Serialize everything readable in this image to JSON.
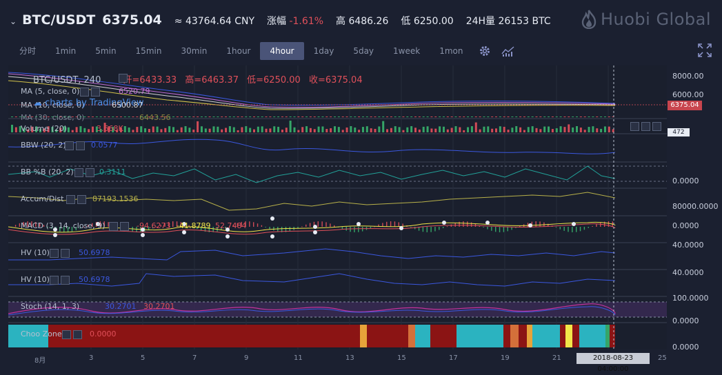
{
  "header": {
    "pair": "BTC/USDT",
    "price": "6375.04",
    "cny": "≈ 43764.64 CNY",
    "change_label": "涨幅",
    "change_value": "-1.61%",
    "high_label": "高",
    "high_value": "6486.26",
    "low_label": "低",
    "low_value": "6250.00",
    "vol_label": "24H量",
    "vol_value": "26153 BTC",
    "logo": "Huobi Global"
  },
  "timeframes": [
    "分时",
    "1min",
    "5min",
    "15min",
    "30min",
    "1hour",
    "4hour",
    "1day",
    "5day",
    "1week",
    "1mon"
  ],
  "active_timeframe": "4hour",
  "icons": {
    "settings": "gear-icon",
    "indicators": "chart-icon",
    "fullscreen": "expand-icon",
    "chevron": "chevron-down-icon"
  },
  "main_legend": {
    "title": "BTC/USDT, 240",
    "open_label": "开=",
    "open": "6433.33",
    "high_label": "高=",
    "high": "6463.37",
    "low_label": "低=",
    "low": "6250.00",
    "close_label": "收=",
    "close": "6375.04"
  },
  "watermark": "charts by TradingView",
  "indicators": [
    {
      "label": "MA (5, close, 0)",
      "value": "6520.79",
      "color": "#c36fd6"
    },
    {
      "label": "MA (10, close, 0)",
      "value": "6500.87",
      "color": "#d3d3d3"
    },
    {
      "label": "MA (30, close, 0)",
      "value": "6443.56",
      "color": "#d4c34a"
    },
    {
      "label": "Volume (20)",
      "value": "3.668K",
      "color": "#e0505a"
    },
    {
      "label": "BBW (20, 2)",
      "value": "0.0577",
      "color": "#3b58e0"
    },
    {
      "label": "BB %B (20, 2)",
      "value": "0.3111",
      "color": "#22a39a"
    },
    {
      "label": "Accum/Dist",
      "value": "87193.1536",
      "color": "#b9b24a"
    },
    {
      "label": "MACD (3, 14, close, 9)",
      "v1": "-94.6273",
      "v2": "-41.8789",
      "v3": "52.7484",
      "c1": "#e0505a",
      "c2": "#f2e649",
      "c3": "#e0505a"
    },
    {
      "label": "HV (10)",
      "value": "50.6978",
      "color": "#3b58e0"
    },
    {
      "label": "HV (10)",
      "value": "50.6978",
      "color": "#3b58e0"
    },
    {
      "label": "Stoch (14, 1, 3)",
      "v1": "30.2701",
      "v2": "30.2701",
      "c1": "#3b58e0",
      "c2": "#e0505a"
    },
    {
      "label": "Choo Zone",
      "value": "0.0000",
      "color": "#e0505a"
    }
  ],
  "right_axis": {
    "price_top": "8000.00",
    "price_mid": "6000.00",
    "price_tag": "6375.04",
    "vol_tag": "472",
    "bbpb": "0.0000",
    "accum": "80000.0000",
    "macd": "0.0000",
    "hv1": "40.0000",
    "hv2": "40.0000",
    "stoch_top": "100.0000",
    "stoch_bot": "0.0000",
    "choo": "0.0000"
  },
  "x_axis": [
    "8月",
    "3",
    "5",
    "7",
    "9",
    "11",
    "13",
    "15",
    "17",
    "19",
    "21",
    "25"
  ],
  "crosshair_date": "2018-08-23 04:00:00",
  "chart_data": {
    "type": "line",
    "close": [
      6830,
      6780,
      6720,
      6650,
      6600,
      6550,
      6480,
      6430,
      6380,
      6350,
      6300,
      6260,
      6250,
      6290,
      6330,
      6380,
      6410,
      6440,
      6470,
      6450,
      6420,
      6390,
      6360,
      6340,
      6330,
      6345,
      6360,
      6380,
      6400,
      6420,
      6440,
      6460,
      6450,
      6430,
      6410,
      6400,
      6390,
      6385,
      6395,
      6405,
      6415,
      6420,
      6410,
      6400,
      6390,
      6385,
      6380,
      6378,
      6376,
      6375.04
    ],
    "ylim": [
      6000,
      8000
    ]
  }
}
